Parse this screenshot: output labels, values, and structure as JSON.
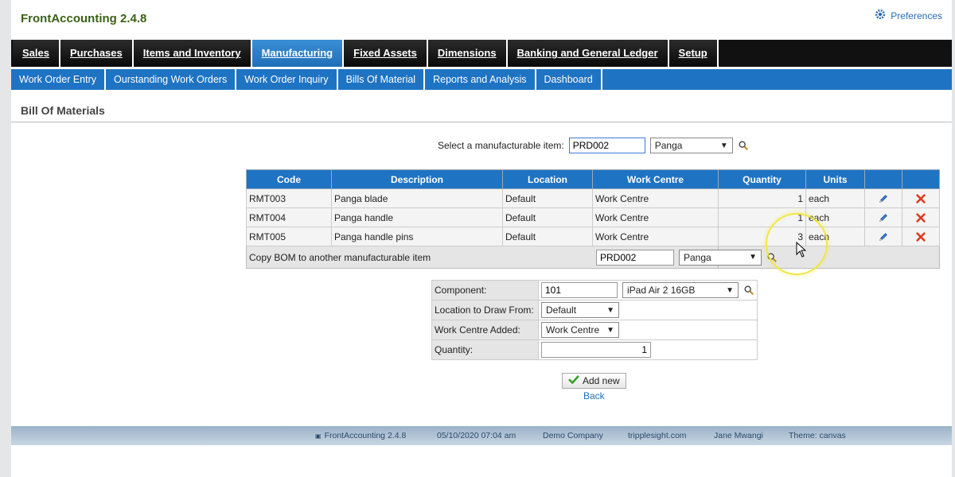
{
  "app": {
    "title": "FrontAccounting 2.4.8",
    "preferences": "Preferences"
  },
  "main_nav": [
    {
      "label": "Sales",
      "active": false
    },
    {
      "label": "Purchases",
      "active": false
    },
    {
      "label": "Items and Inventory",
      "active": false
    },
    {
      "label": "Manufacturing",
      "active": true
    },
    {
      "label": "Fixed Assets",
      "active": false
    },
    {
      "label": "Dimensions",
      "active": false
    },
    {
      "label": "Banking and General Ledger",
      "active": false
    },
    {
      "label": "Setup",
      "active": false
    }
  ],
  "sub_nav": [
    "Work Order Entry",
    "Ourstanding Work Orders",
    "Work Order Inquiry",
    "Bills Of Material",
    "Reports and Analysis",
    "Dashboard"
  ],
  "page": {
    "title": "Bill Of Materials"
  },
  "item_select": {
    "label": "Select a manufacturable item:",
    "code": "PRD002",
    "name": "Panga"
  },
  "bom_table": {
    "headers": [
      "Code",
      "Description",
      "Location",
      "Work Centre",
      "Quantity",
      "Units"
    ],
    "rows": [
      {
        "code": "RMT003",
        "description": "Panga blade",
        "location": "Default",
        "work_centre": "Work Centre",
        "quantity": "1",
        "units": "each"
      },
      {
        "code": "RMT004",
        "description": "Panga handle",
        "location": "Default",
        "work_centre": "Work Centre",
        "quantity": "1",
        "units": "each"
      },
      {
        "code": "RMT005",
        "description": "Panga handle pins",
        "location": "Default",
        "work_centre": "Work Centre",
        "quantity": "3",
        "units": "each"
      }
    ],
    "copy": {
      "label": "Copy BOM to another manufacturable item",
      "code": "PRD002",
      "name": "Panga"
    }
  },
  "component_form": {
    "component_label": "Component:",
    "component_code": "101",
    "component_name": "iPad Air 2 16GB",
    "location_label": "Location to Draw From:",
    "location_value": "Default",
    "work_centre_label": "Work Centre Added:",
    "work_centre_value": "Work Centre",
    "quantity_label": "Quantity:",
    "quantity_value": "1"
  },
  "actions": {
    "add_new": "Add new",
    "back": "Back"
  },
  "footer": {
    "version": "FrontAccounting 2.4.8",
    "datetime": "05/10/2020 07:04 am",
    "company": "Demo Company",
    "host": "tripplesight.com",
    "user": "Jane Mwangi",
    "theme": "Theme: canvas"
  },
  "colors": {
    "nav_blue": "#1f73c3",
    "title_green": "#3b6114",
    "delete_red": "#e03a1e",
    "add_green": "#3aa12a"
  }
}
